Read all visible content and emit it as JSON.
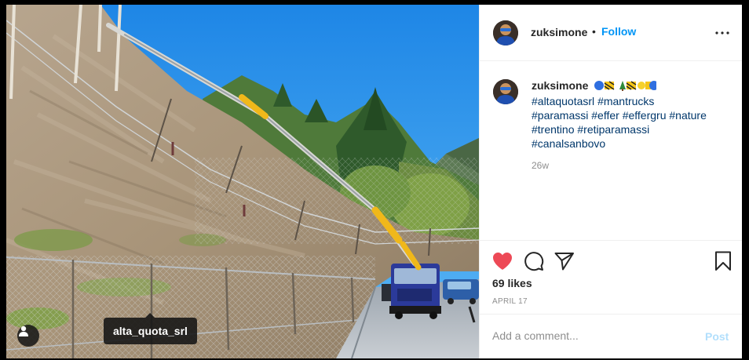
{
  "post": {
    "username": "zuksimone",
    "dot": "•",
    "follow_label": "Follow",
    "more_icon": "more-horizontal-icon",
    "caption": {
      "username": "zuksimone",
      "hashtags": [
        "#altaquotasrl",
        "#mantrucks",
        "#paramassi",
        "#effer",
        "#effergru",
        "#nature",
        "#trentino",
        "#retiparamassi",
        "#canalsanbovo"
      ]
    },
    "time_ago": "26w",
    "likes": "69 likes",
    "date": "APRIL 17",
    "comment_placeholder": "Add a comment...",
    "post_label": "Post"
  },
  "photo": {
    "tag_label": "alta_quota_srl",
    "user_tag_icon": "user-icon"
  },
  "colors": {
    "like_red": "#ed4956",
    "link_blue": "#0095f6",
    "hashtag_blue": "#00376b",
    "post_disabled": "#b2dffc"
  }
}
